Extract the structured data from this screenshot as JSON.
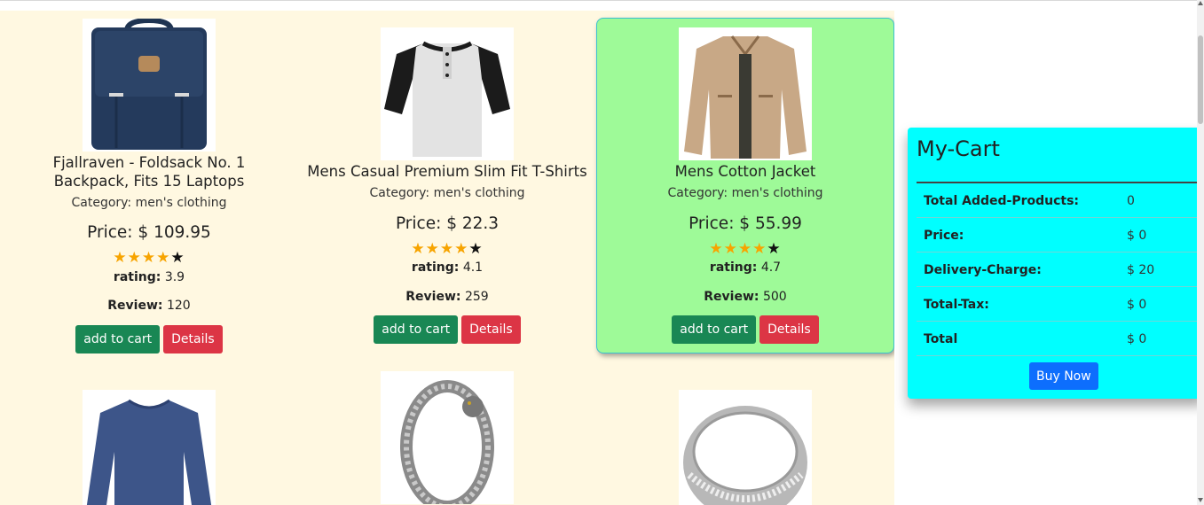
{
  "products": [
    {
      "title": "Fjallraven - Foldsack No. 1 Backpack, Fits 15 Laptops",
      "category": "Category: men's clothing",
      "price": "Price: $ 109.95",
      "rating_label": "rating:",
      "rating": "3.9",
      "review_label": "Review:",
      "review": "120",
      "image_icon": "backpack-image",
      "stars_filled": 4
    },
    {
      "title": "Mens Casual Premium Slim Fit T-Shirts",
      "category": "Category: men's clothing",
      "price": "Price: $ 22.3",
      "rating_label": "rating:",
      "rating": "4.1",
      "review_label": "Review:",
      "review": "259",
      "image_icon": "tshirt-image",
      "stars_filled": 4
    },
    {
      "title": "Mens Cotton Jacket",
      "category": "Category: men's clothing",
      "price": "Price: $ 55.99",
      "rating_label": "rating:",
      "rating": "4.7",
      "review_label": "Review:",
      "review": "500",
      "image_icon": "jacket-image",
      "stars_filled": 4
    },
    {
      "image_icon": "longsleeve-shirt-image"
    },
    {
      "image_icon": "bracelet-image"
    },
    {
      "image_icon": "ring-image"
    }
  ],
  "buttons": {
    "add_to_cart": "add to cart",
    "details": "Details"
  },
  "cart": {
    "title": "My-Cart",
    "rows": [
      {
        "label": "Total Added-Products:",
        "value": "0"
      },
      {
        "label": "Price:",
        "value": "$ 0"
      },
      {
        "label": "Delivery-Charge:",
        "value": "$ 20"
      },
      {
        "label": "Total-Tax:",
        "value": "$ 0"
      },
      {
        "label": "Total",
        "value": "$ 0"
      }
    ],
    "buy_label": "Buy Now"
  },
  "colors": {
    "products_bg": "#fff8e1",
    "highlight_card": "#9efa98",
    "cart_bg": "#00ffff",
    "green_button": "#198754",
    "red_button": "#dc3545",
    "blue_button": "#0d6efd",
    "star": "#f7a400"
  }
}
